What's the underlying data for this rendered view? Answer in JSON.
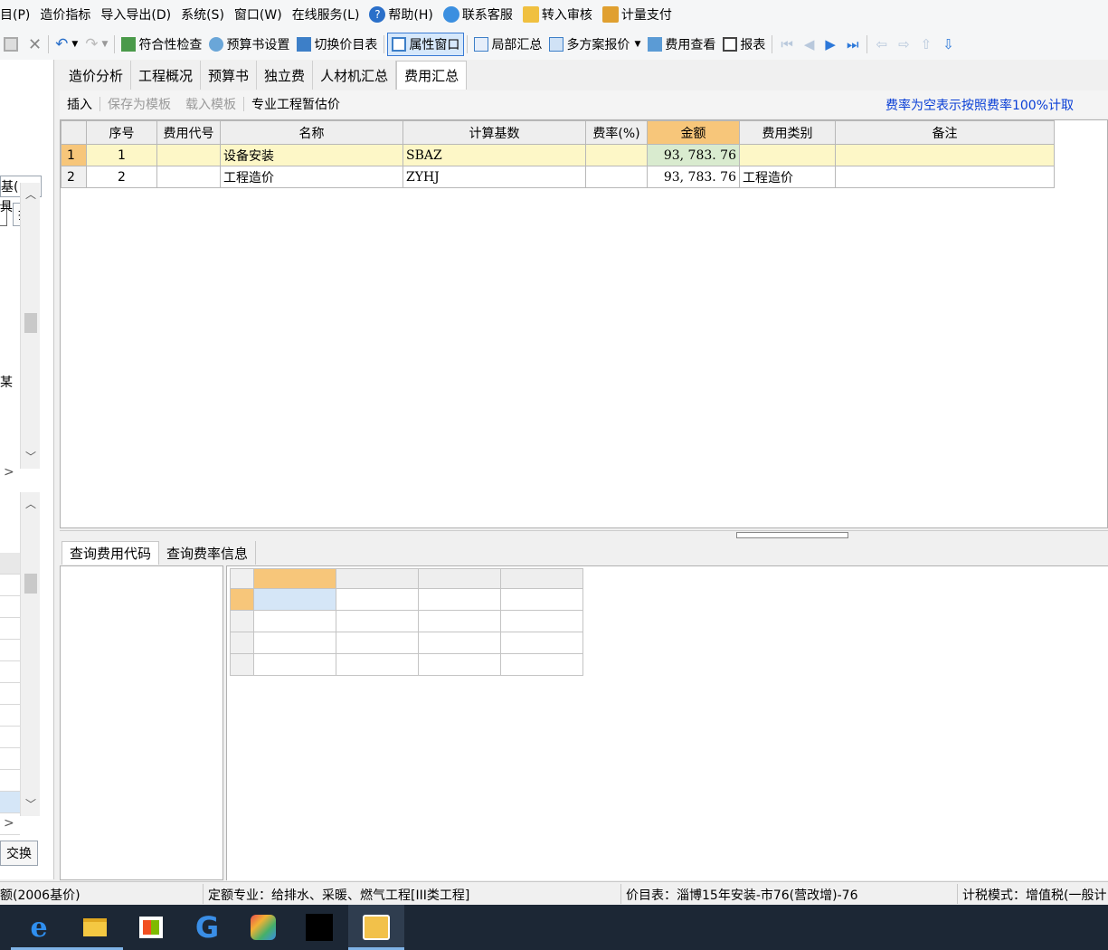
{
  "menu": {
    "items": [
      "目(P)",
      "造价指标",
      "导入导出(D)",
      "系统(S)",
      "窗口(W)",
      "在线服务(L)",
      "帮助(H)",
      "联系客服",
      "转入审核",
      "计量支付"
    ]
  },
  "toolbar": {
    "compliance_check": "符合性检查",
    "budget_settings": "预算书设置",
    "switch_price_list": "切换价目表",
    "property_window": "属性窗口",
    "partial_summary": "局部汇总",
    "multi_plan_quote": "多方案报价",
    "fee_view": "费用查看",
    "report": "报表"
  },
  "left_panel": {
    "combo_value": "基(",
    "search_button": "搜",
    "fragment_1": "具",
    "fragment_2": "某",
    "swap_button": "交换"
  },
  "tabs": [
    "造价分析",
    "工程概况",
    "预算书",
    "独立费",
    "人材机汇总",
    "费用汇总"
  ],
  "active_tab": "费用汇总",
  "subtoolbar": {
    "insert": "插入",
    "save_template": "保存为模板",
    "load_template": "载入模板",
    "provisional": "专业工程暂估价",
    "note": "费率为空表示按照费率100%计取"
  },
  "fee_table": {
    "headers": [
      "序号",
      "费用代号",
      "名称",
      "计算基数",
      "费率(%)",
      "金额",
      "费用类别",
      "备注"
    ],
    "rows": [
      {
        "row": "1",
        "seq": "1",
        "code": "",
        "name": "设备安装",
        "base": "SBAZ",
        "rate": "",
        "amount": "93, 783. 76",
        "category": "",
        "remark": ""
      },
      {
        "row": "2",
        "seq": "2",
        "code": "",
        "name": "工程造价",
        "base": "ZYHJ",
        "rate": "",
        "amount": "93, 783. 76",
        "category": "工程造价",
        "remark": ""
      }
    ]
  },
  "bottom_tabs": [
    "查询费用代码",
    "查询费率信息"
  ],
  "status": {
    "quota": "额(2006基价)",
    "specialty": "定额专业：给排水、采暖、燃气工程[III类工程]",
    "price_list": "价目表：淄博15年安装-市76(营改增)-76",
    "tax_mode": "计税模式：增值税(一般计"
  },
  "colors": {
    "selected_row": "#fdf7c7",
    "header_highlight": "#f7c67a",
    "amount_cell": "#d9ebcf",
    "note_text": "#0a3fd6",
    "taskbar": "#1c2735"
  }
}
